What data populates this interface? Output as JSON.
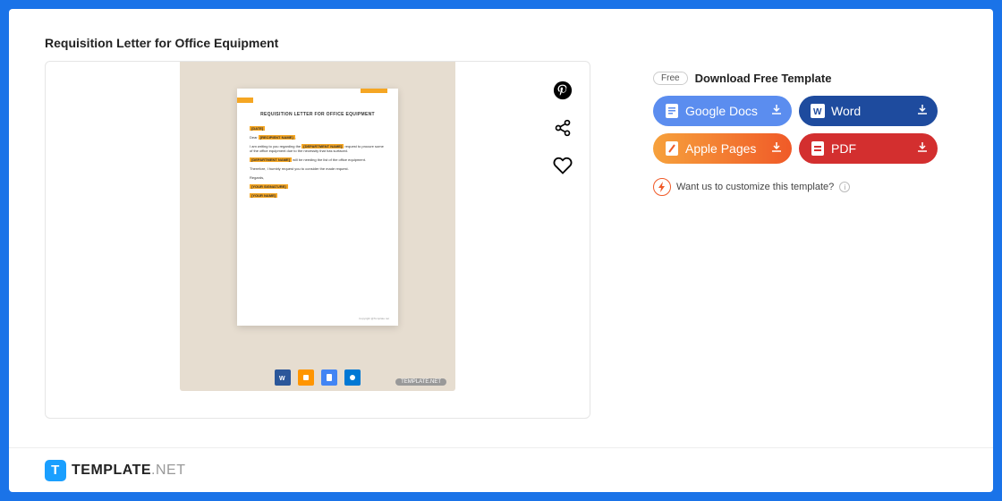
{
  "title": "Requisition Letter for Office Equipment",
  "preview": {
    "doc_title": "REQUISITION LETTER FOR OFFICE EQUIPMENT",
    "fields": {
      "date": "[DATE]",
      "recipient": "[RECIPIENT NAME]",
      "dept": "[DEPARTMENT NAME]",
      "dept2": "[DEPARTMENT NAME]",
      "sig": "[YOUR SIGNATURE]",
      "name": "[YOUR NAME]"
    },
    "dear": "Dear",
    "body1a": "I am writing to you regarding the",
    "body1b": "request to procure some of the office",
    "body1c": "equipment due to the necessity that has surfaced.",
    "body2": "will be needing the list of the office equipment.",
    "body3": "Therefore, I humbly request you to consider the made request.",
    "regards": "Regards,",
    "foot": "Copyright @Template.net",
    "tag": "TEMPLATE.NET"
  },
  "download": {
    "free": "Free",
    "title": "Download Free Template",
    "buttons": {
      "gdocs": "Google Docs",
      "word": "Word",
      "pages": "Apple Pages",
      "pdf": "PDF"
    }
  },
  "customize": {
    "text": "Want us to customize this template?"
  },
  "footer": {
    "brand": "TEMPLATE",
    "suffix": ".NET"
  }
}
